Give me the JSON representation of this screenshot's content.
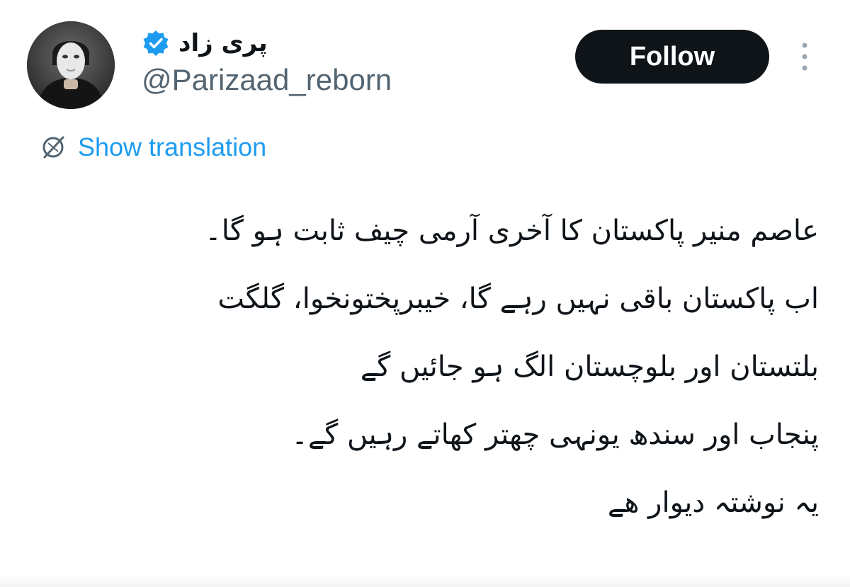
{
  "author": {
    "display_name": "پری زاد",
    "handle": "@Parizaad_reborn",
    "verified": true,
    "avatar_icon": "masked-person-avatar"
  },
  "actions": {
    "follow_label": "Follow",
    "more_icon": "more-vertical-icon"
  },
  "translation": {
    "label": "Show translation",
    "icon": "globe-icon"
  },
  "tweet": {
    "lines": [
      "عاصم منیر پاکستان کا آخری آرمی چیف ثابت ہو گا۔",
      "اب پاکستان باقی نہیں رہے گا، خیبرپختونخوا، گلگت",
      "بلتستان اور بلوچستان الگ ہو جائیں گے",
      "پنجاب اور سندھ یونہی چھتر کھاتے رہیں گے۔",
      "یہ نوشتہ دیوار ھے"
    ]
  },
  "colors": {
    "text": "#0f1419",
    "secondary": "#536471",
    "link": "#1d9bf0",
    "follow_bg": "#0f1419",
    "follow_text": "#ffffff",
    "verified": "#1d9bf0"
  }
}
